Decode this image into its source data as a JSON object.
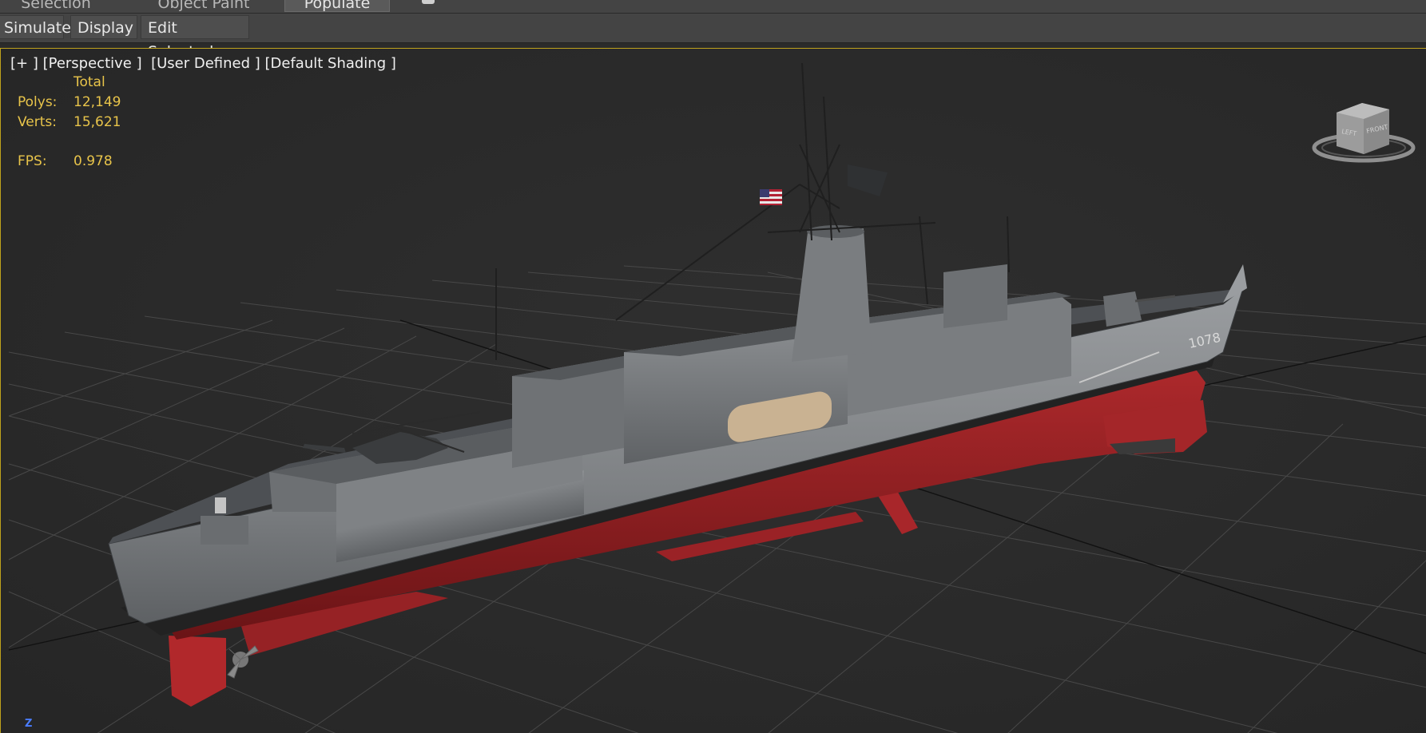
{
  "ribbon": {
    "tabs": [
      {
        "label": "Selection",
        "active": false
      },
      {
        "label": "Object Paint",
        "active": false
      },
      {
        "label": "Populate",
        "active": true
      }
    ]
  },
  "toolbar": {
    "simulate_label": "Simulate",
    "display_label": "Display",
    "edit_selected_label": "Edit Selected"
  },
  "viewport": {
    "menu_plus": "[+ ]",
    "menu_view": "[Perspective ]",
    "menu_style": "[User Defined ]",
    "menu_shading": "[Default Shading ]",
    "stats": {
      "header": "Total",
      "polys_label": "Polys:",
      "polys_value": "12,149",
      "verts_label": "Verts:",
      "verts_value": "15,621",
      "fps_label": "FPS:",
      "fps_value": "0.978"
    },
    "viewcube": {
      "face_left": "LEFT",
      "face_front": "FRONT"
    },
    "axis_label": "Z",
    "hull_number": "1078"
  },
  "colors": {
    "viewport_border": "#bfa21c",
    "stats_text": "#e8c44a",
    "hull_grey": "#8a8d90",
    "hull_red": "#a8262a",
    "grid": "#4a4a4a",
    "axis_z": "#4a7cff"
  }
}
